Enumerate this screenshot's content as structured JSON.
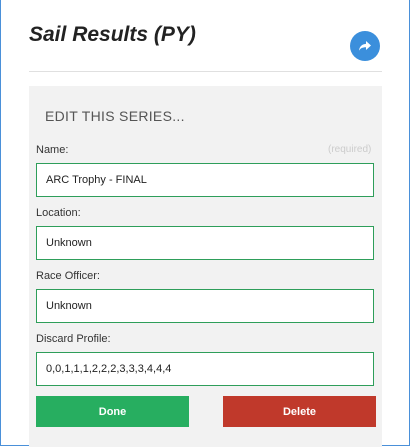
{
  "header": {
    "title": "Sail Results (PY)",
    "share_icon": "share-icon"
  },
  "form": {
    "section_title": "EDIT THIS SERIES...",
    "name": {
      "label": "Name:",
      "required_note": "(required)",
      "value": "ARC Trophy - FINAL"
    },
    "location": {
      "label": "Location:",
      "value": "Unknown"
    },
    "race_officer": {
      "label": "Race Officer:",
      "value": "Unknown"
    },
    "discard_profile": {
      "label": "Discard Profile:",
      "value": "0,0,1,1,1,2,2,2,3,3,3,4,4,4"
    }
  },
  "actions": {
    "done_label": "Done",
    "delete_label": "Delete"
  },
  "colors": {
    "accent": "#3b8fdc",
    "input_border": "#2e9e5a",
    "done": "#27ae60",
    "delete": "#c0392b"
  }
}
